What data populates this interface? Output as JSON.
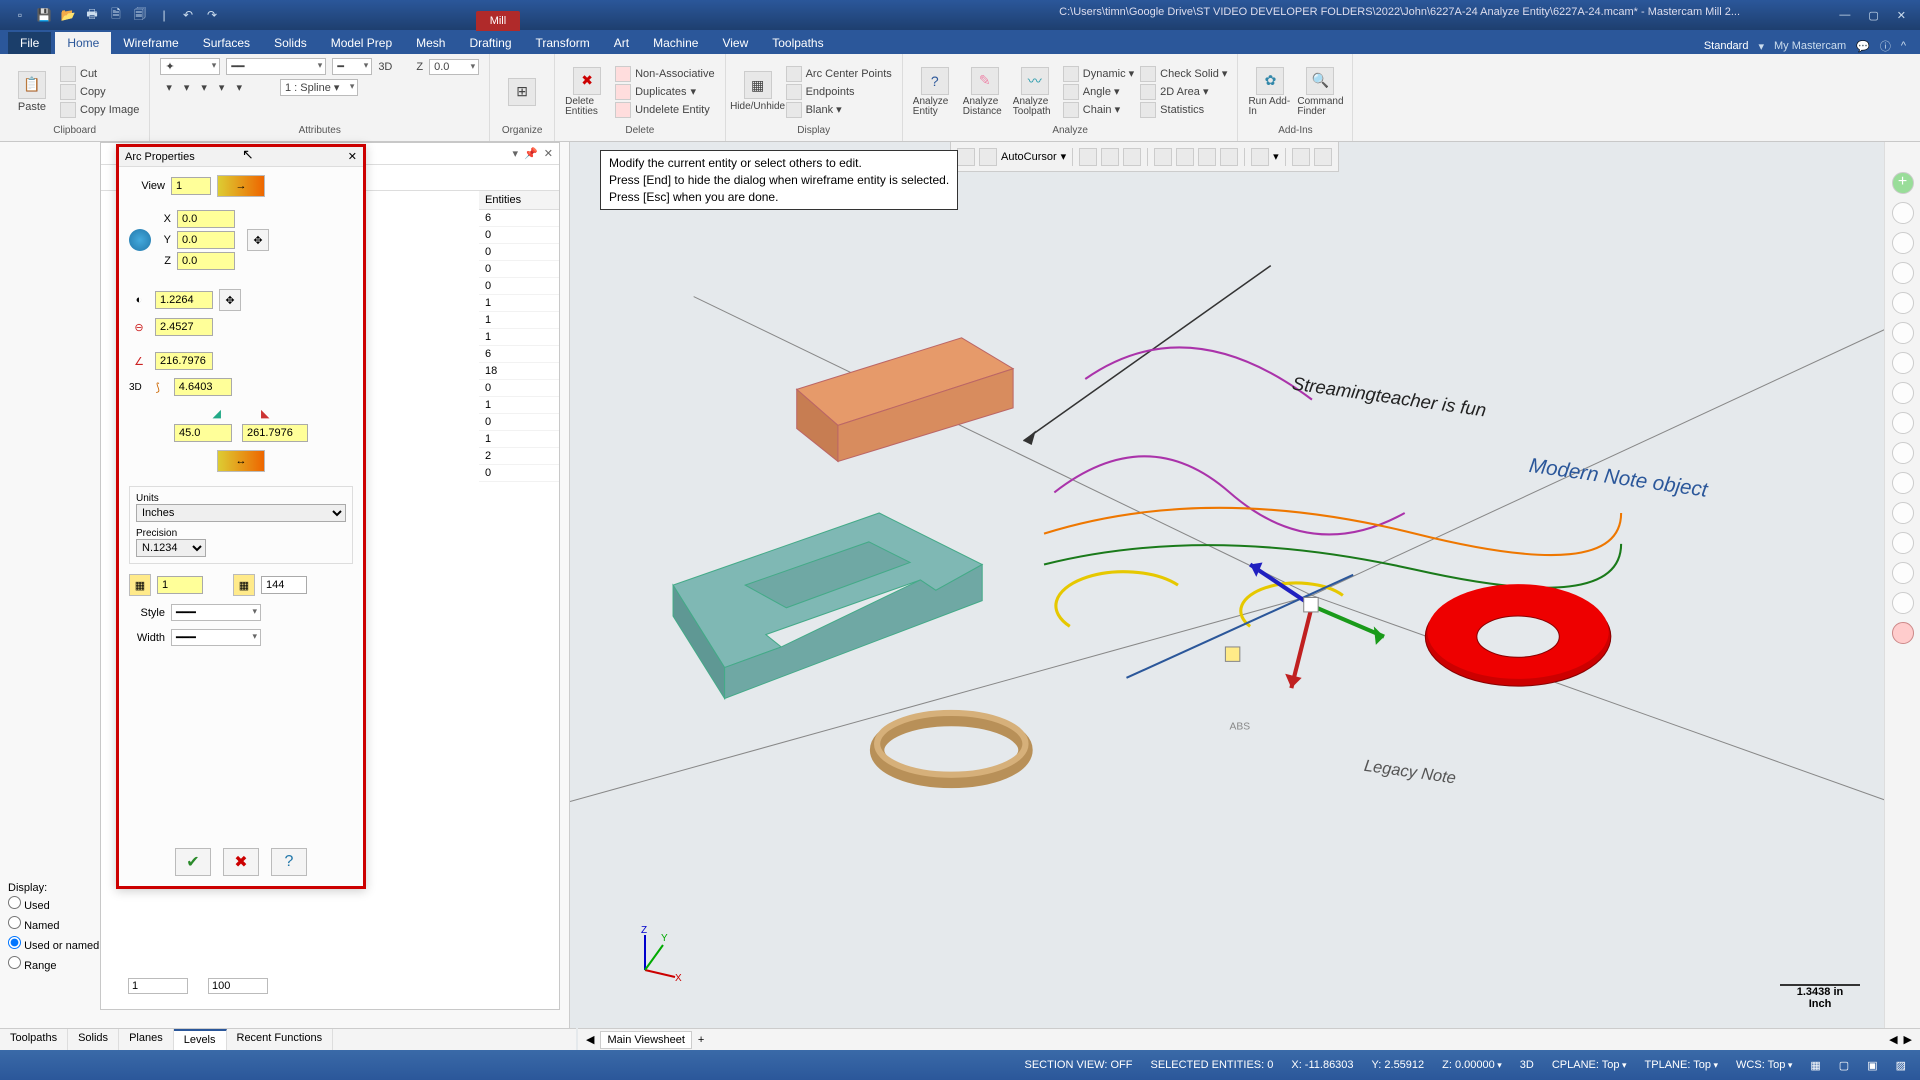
{
  "titlebar": {
    "mill": "Mill",
    "path": "C:\\Users\\timn\\Google Drive\\ST VIDEO DEVELOPER FOLDERS\\2022\\John\\6227A-24 Analyze Entity\\6227A-24.mcam* - Mastercam Mill 2..."
  },
  "tabs": {
    "file": "File",
    "items": [
      "Home",
      "Wireframe",
      "Surfaces",
      "Solids",
      "Model Prep",
      "Mesh",
      "Drafting",
      "Transform",
      "Art",
      "Machine",
      "View",
      "Toolpaths"
    ],
    "active": "Home",
    "standard": "Standard",
    "mymc": "My Mastercam"
  },
  "ribbon": {
    "clipboard": {
      "label": "Clipboard",
      "paste": "Paste",
      "cut": "Cut",
      "copy": "Copy",
      "copyimg": "Copy Image"
    },
    "attributes": {
      "label": "Attributes",
      "mode": "3D",
      "z": "Z",
      "zval": "0.0",
      "spline": "1 : Spline ▾"
    },
    "organize": {
      "label": "Organize"
    },
    "delete": {
      "label": "Delete",
      "delent": "Delete Entities",
      "nonassoc": "Non-Associative",
      "dup": "Duplicates",
      "undel": "Undelete Entity"
    },
    "display": {
      "label": "Display",
      "hide": "Hide/Unhide",
      "arccenter": "Arc Center Points",
      "endpoints": "Endpoints",
      "blank": "Blank ▾"
    },
    "analyze": {
      "label": "Analyze",
      "ae": "Analyze Entity",
      "ad": "Analyze Distance",
      "at": "Analyze Toolpath",
      "dyn": "Dynamic ▾",
      "ang": "Angle ▾",
      "chain": "Chain ▾",
      "cs": "Check Solid ▾",
      "area": "2D Area ▾",
      "stats": "Statistics"
    },
    "addins": {
      "label": "Add-Ins",
      "run": "Run Add-In",
      "cf": "Command Finder"
    }
  },
  "levels": {
    "entities_hdr": "Entities",
    "values": [
      "6",
      "0",
      "0",
      "0",
      "0",
      "1",
      "1",
      "1",
      "6",
      "18",
      "0",
      "1",
      "0",
      "1",
      "2",
      "0"
    ]
  },
  "display_opts": {
    "label": "Display:",
    "used": "Used",
    "named": "Named",
    "usedornamed": "Used or named",
    "range": "Range",
    "from": "1",
    "to": "100"
  },
  "arc": {
    "title": "Arc Properties",
    "view_lbl": "View",
    "view": "1",
    "x": "0.0",
    "y": "0.0",
    "z": "0.0",
    "radius": "1.2264",
    "diameter": "2.4527",
    "sweep": "216.7976",
    "arclen": "4.6403",
    "threeD": "3D",
    "start": "45.0",
    "end": "261.7976",
    "units_lbl": "Units",
    "units": "Inches",
    "precision_lbl": "Precision",
    "precision": "N.1234",
    "level": "1",
    "color": "144",
    "style_lbl": "Style",
    "width_lbl": "Width"
  },
  "hint": {
    "l1": "Modify the current entity or select others to edit.",
    "l2": "Press [End] to hide the dialog when wireframe entity is selected.",
    "l3": "Press [Esc] when you are done."
  },
  "float_tb": {
    "autocursor": "AutoCursor"
  },
  "viewport": {
    "note1": "Streamingteacher is fun",
    "note2": "Modern Note object",
    "note3": "Legacy Note",
    "abs": "ABS",
    "scale": "1.3438 in",
    "scale_unit": "Inch",
    "viewsheet": "Main Viewsheet"
  },
  "bottom_tabs": {
    "tp": "Toolpaths",
    "solids": "Solids",
    "planes": "Planes",
    "levels": "Levels",
    "recent": "Recent Functions"
  },
  "status": {
    "section": "SECTION VIEW: OFF",
    "sel": "SELECTED ENTITIES: 0",
    "x": "X: -11.86303",
    "y": "Y: 2.55912",
    "z": "Z: 0.00000",
    "mode": "3D",
    "cplane": "CPLANE: Top",
    "tplane": "TPLANE: Top",
    "wcs": "WCS: Top"
  }
}
